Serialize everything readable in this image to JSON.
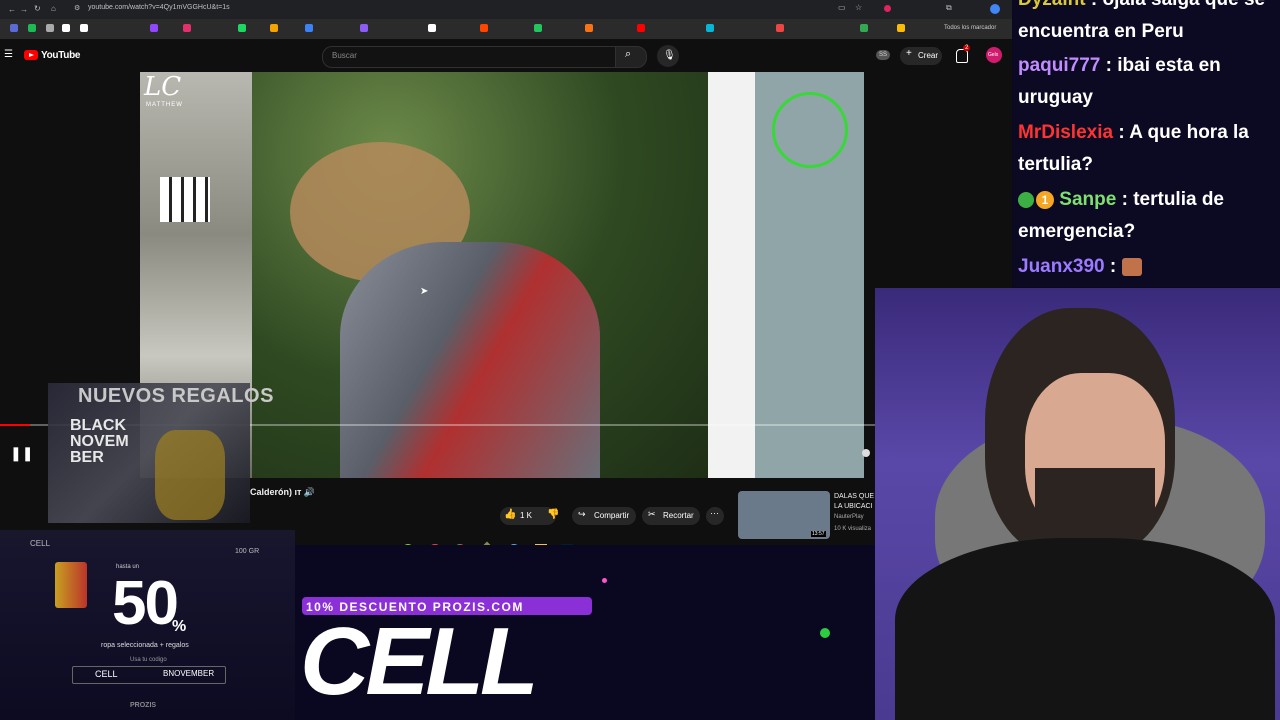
{
  "browser": {
    "url": "youtube.com/watch?v=4Qy1mVGGHcU&t=1s",
    "bookmarks_label": "Todos los marcador"
  },
  "youtube": {
    "logo_text": "YouTube",
    "search_placeholder": "Buscar",
    "create_label": "Crear",
    "notif_count": "2",
    "avatar_text": "Gelx",
    "ss_badge": "SS",
    "video_title": "Calderón) ıт 🔊",
    "watermark": "LC",
    "watermark_sub": "MATTHEW",
    "like_count": "1 K",
    "share_label": "Compartir",
    "clip_label": "Recortar",
    "reco_title": "DALAS QUE LA UBICACI",
    "reco_channel": "NauterPlay",
    "reco_views": "10 K visualiza",
    "reco_duration": "13:57",
    "progress": 0.034
  },
  "chat": [
    {
      "user": "Dyzaint",
      "user_color": "#d9c83a",
      "text": ": ojala salga que se encuentra en Peru",
      "badges": ""
    },
    {
      "user": "paqui777",
      "user_color": "#c08cff",
      "text": ": ibai esta en uruguay",
      "badges": ""
    },
    {
      "user": "MrDislexia",
      "user_color": "#ff3333",
      "text": ": A que hora la tertulia?",
      "badges": ""
    },
    {
      "user": "Sanpe",
      "user_color": "#7ee06e",
      "text": ": tertulia de emergencia?",
      "badges": "1"
    },
    {
      "user": "Juanx390",
      "user_color": "#9b7bff",
      "text": ":",
      "badges": ""
    }
  ],
  "ad_left": {
    "headline": "NUEVOS REGALOS",
    "black": "BLACK",
    "novem": "NOVEM",
    "ber": "BER",
    "hasta": "hasta un",
    "percent": "50",
    "percent_sign": "%",
    "sub": "ropa seleccionada + regalos",
    "sub2": "Usa tu codigo",
    "code1": "CELL",
    "code2": "BNOVEMBER",
    "brand": "PROZIS",
    "chip1": "CELL",
    "chip2": "100 GR"
  },
  "ad_bottom": {
    "promo": "10% DESCUENTO PROZIS.COM",
    "code": "CELL"
  }
}
